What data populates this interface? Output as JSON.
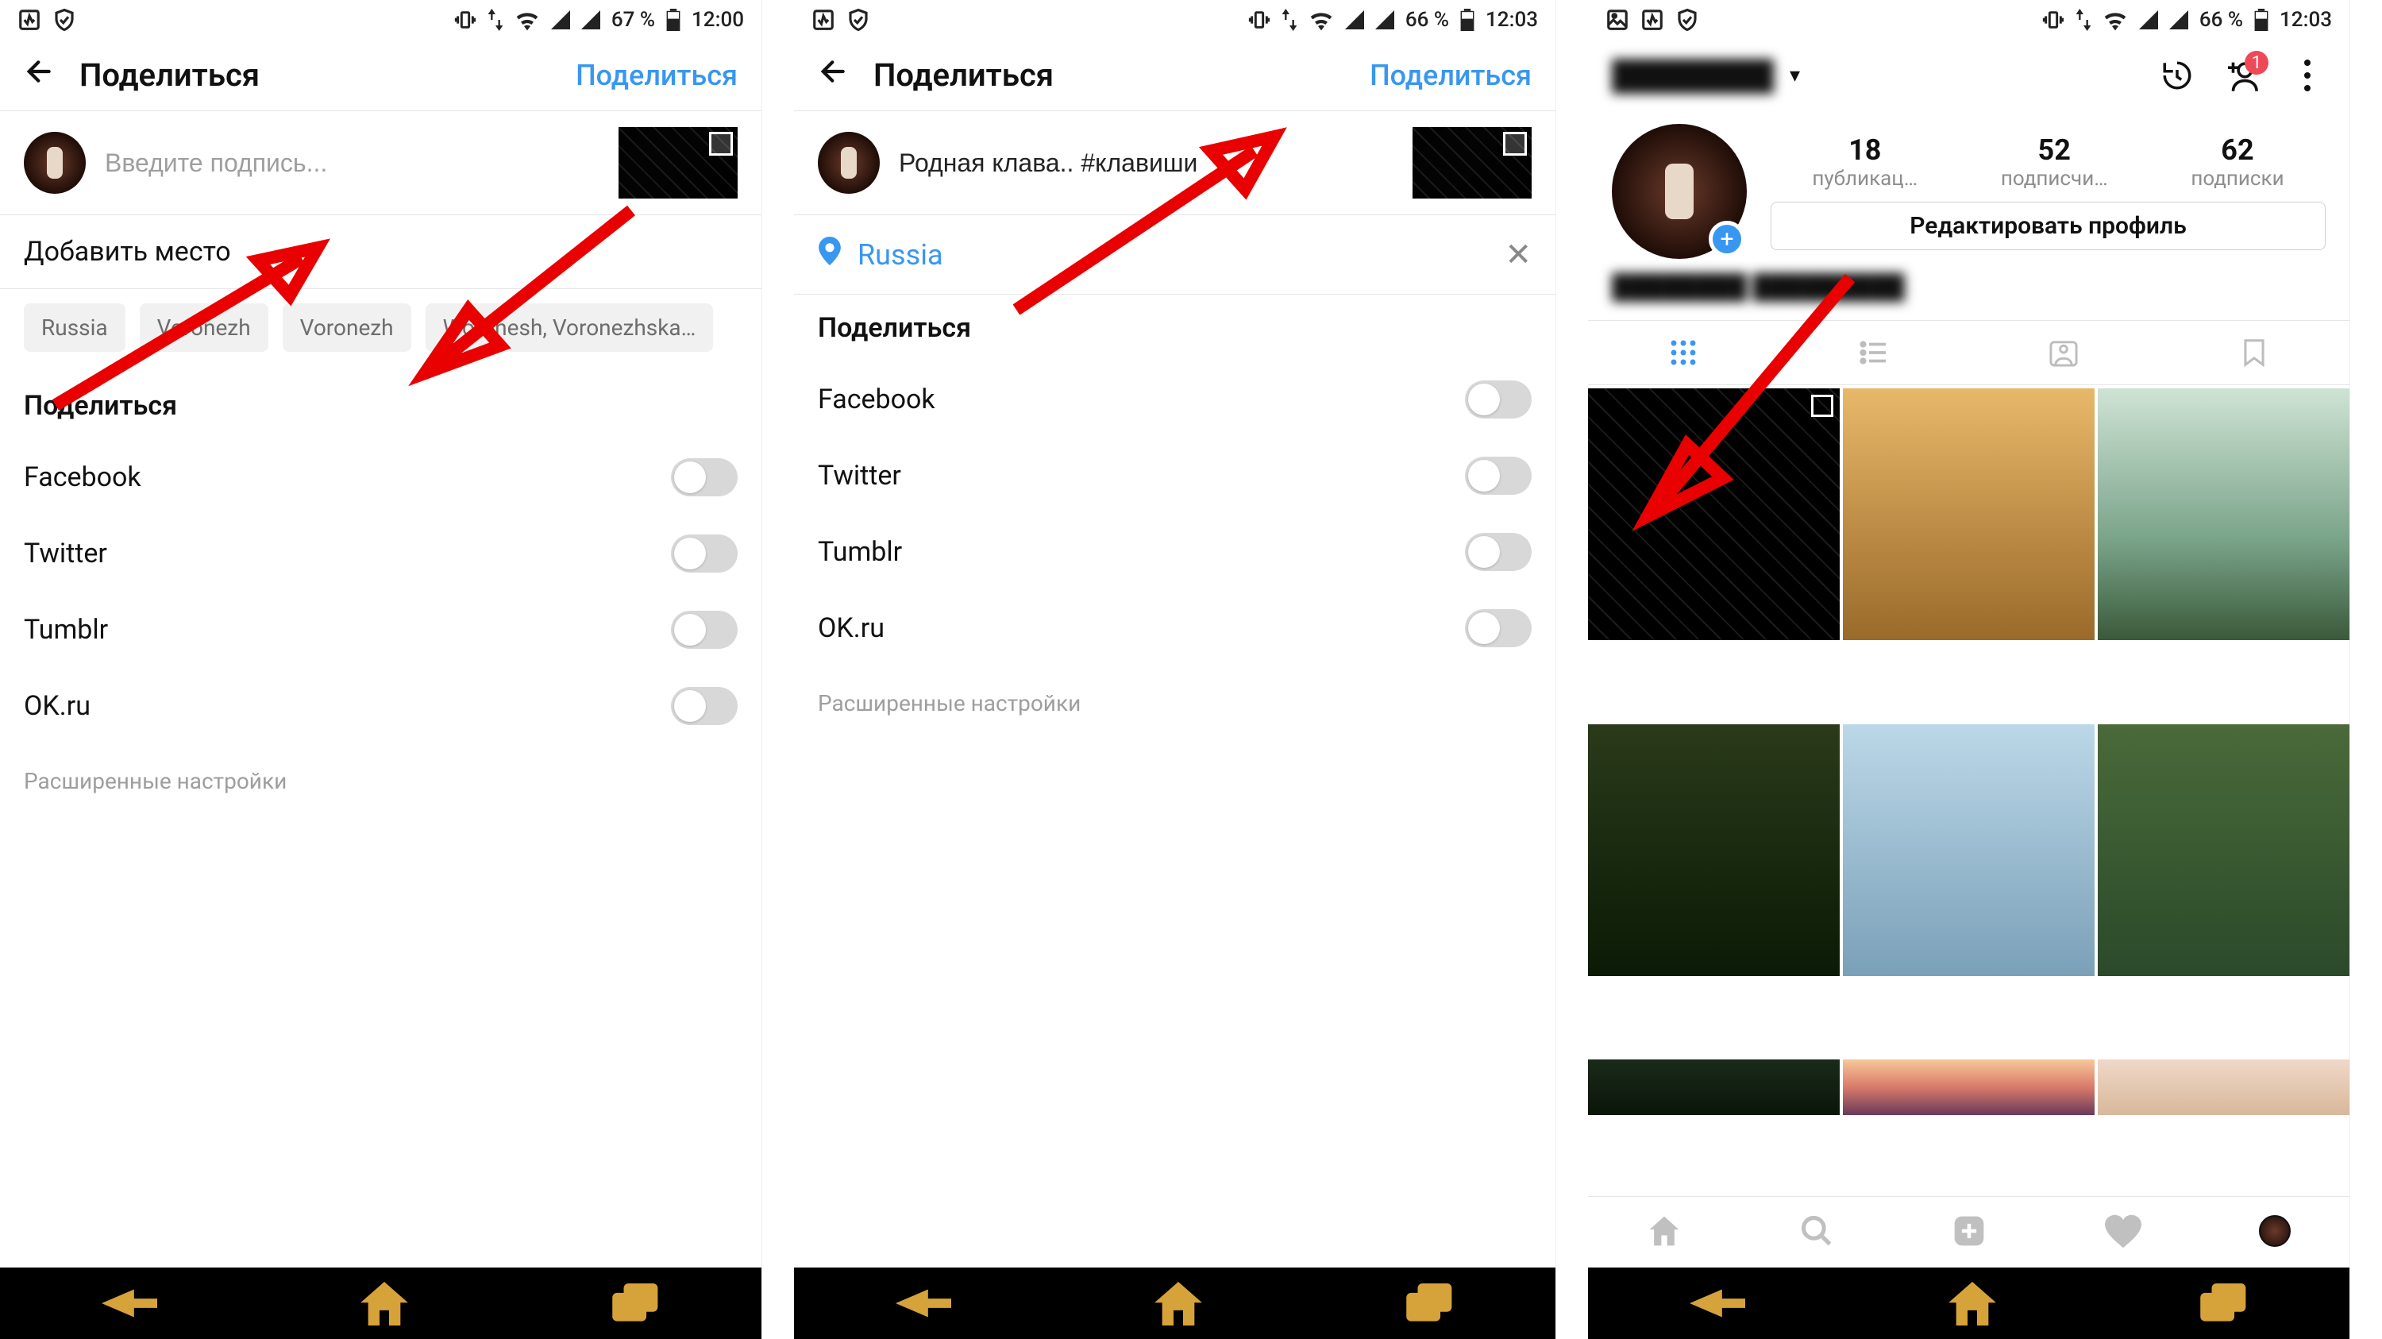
{
  "status": {
    "battery1": "67 %",
    "battery2": "66 %",
    "battery3": "66 %",
    "time1": "12:00",
    "time2": "12:03",
    "time3": "12:03"
  },
  "share": {
    "back_title": "Поделиться",
    "action": "Поделиться",
    "caption_placeholder": "Введите подпись...",
    "caption_filled": "Родная клава.. #клавиши",
    "add_location": "Добавить место",
    "selected_location": "Russia",
    "chips": [
      "Russia",
      "Voronezh",
      "Voronezh",
      "Woronesh, Voronezhska…"
    ],
    "section": "Поделиться",
    "networks": [
      "Facebook",
      "Twitter",
      "Tumblr",
      "OK.ru"
    ],
    "advanced": "Расширенные настройки"
  },
  "profile": {
    "username": "████████",
    "display_name": "████████ █████████",
    "badge_count": "1",
    "stats": {
      "posts_n": "18",
      "posts_l": "публикац…",
      "followers_n": "52",
      "followers_l": "подписчи…",
      "following_n": "62",
      "following_l": "подписки"
    },
    "edit": "Редактировать профиль"
  }
}
